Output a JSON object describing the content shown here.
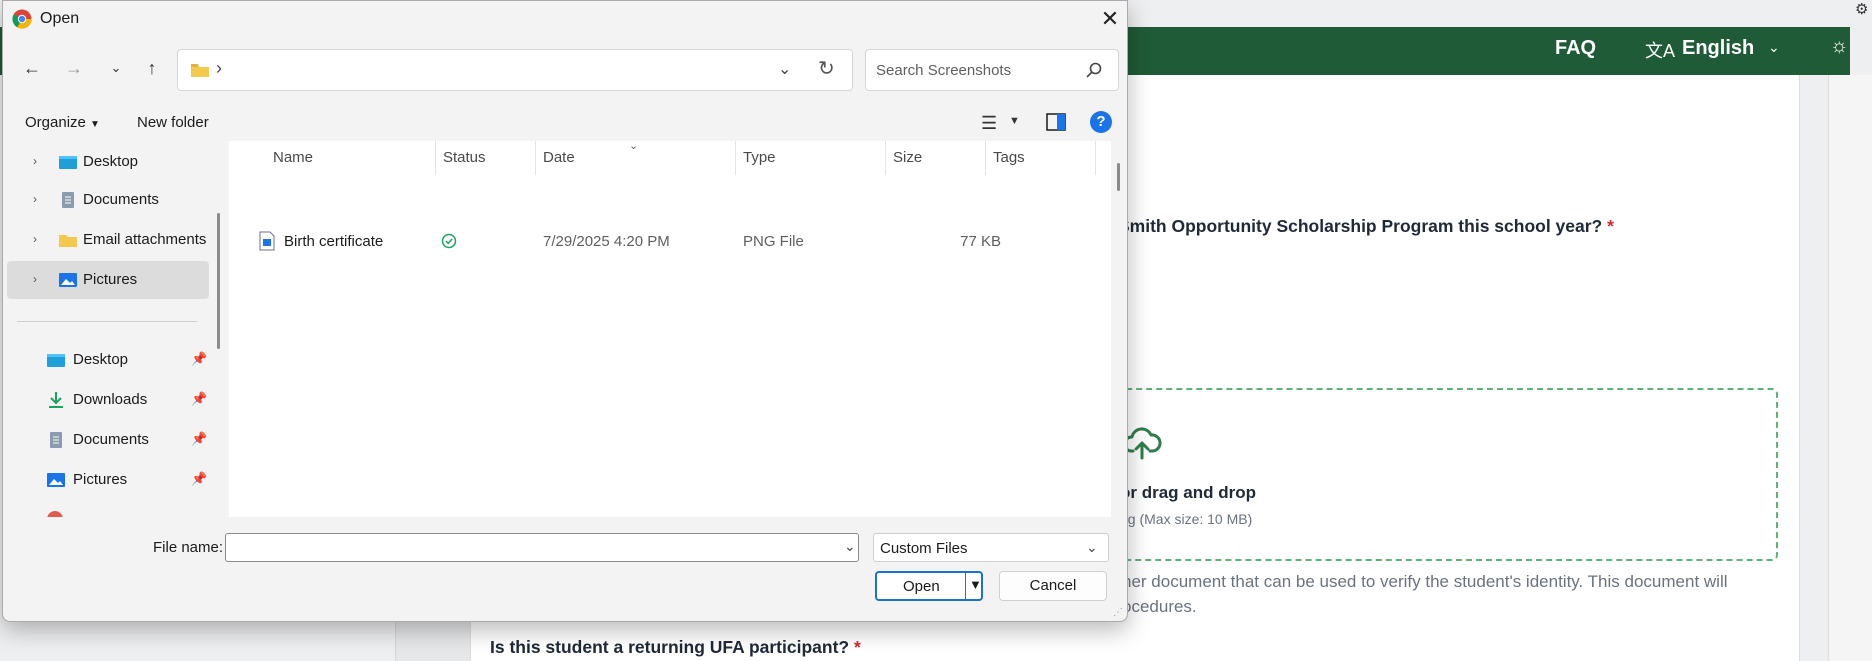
{
  "webpage": {
    "faq": "FAQ",
    "language": "English",
    "question1": "Smith Opportunity Scholarship Program this school year?",
    "required_mark": "*",
    "dropzone_main": "or drag and drop",
    "dropzone_sub": "ng (Max size: 10 MB)",
    "doc_line1": "her document that can be used to verify the student's identity. This document will",
    "doc_line2": "ocedures.",
    "question2": "Is this student a returning UFA participant?",
    "accent_color": "#1f5b36",
    "dropzone_border_color": "#5cb27a"
  },
  "dialog": {
    "title": "Open",
    "address": {
      "separator": "›"
    },
    "search": {
      "placeholder": "Search Screenshots"
    },
    "commands": {
      "organize": "Organize",
      "new_folder": "New folder"
    },
    "nav_tree": [
      {
        "label": "Desktop",
        "icon": "desktop-folder-icon",
        "selected": false
      },
      {
        "label": "Documents",
        "icon": "documents-icon",
        "selected": false
      },
      {
        "label": "Email attachments",
        "icon": "folder-icon",
        "selected": false
      },
      {
        "label": "Pictures",
        "icon": "pictures-icon",
        "selected": true
      }
    ],
    "quick_access": [
      {
        "label": "Desktop",
        "icon": "desktop-folder-icon"
      },
      {
        "label": "Downloads",
        "icon": "download-icon"
      },
      {
        "label": "Documents",
        "icon": "documents-icon"
      },
      {
        "label": "Pictures",
        "icon": "pictures-icon"
      }
    ],
    "columns": [
      "Name",
      "Status",
      "Date",
      "Type",
      "Size",
      "Tags"
    ],
    "files": [
      {
        "name": "Birth certificate",
        "status": "synced",
        "date": "7/29/2025 4:20 PM",
        "type": "PNG File",
        "size": "77 KB",
        "tags": ""
      }
    ],
    "file_name": {
      "label": "File name:",
      "value": ""
    },
    "file_type_filter": "Custom Files",
    "buttons": {
      "open": "Open",
      "cancel": "Cancel"
    }
  }
}
